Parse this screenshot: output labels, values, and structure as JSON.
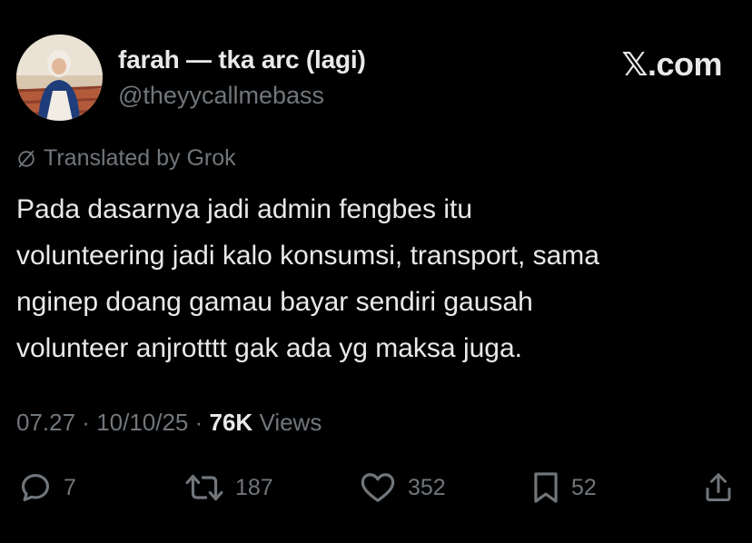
{
  "author": {
    "display_name": "farah — tka arc (lagi)",
    "handle": "@theyycallmebass",
    "avatar_icon": "profile-photo"
  },
  "brand": "𝕏.com",
  "translation_note": "Translated by Grok",
  "post_text": "Pada dasarnya jadi admin fengbes itu\nvolunteering jadi kalo konsumsi, transport, sama\nnginep doang gamau bayar sendiri gausah\nvolunteer anjrotttt gak ada yg maksa juga.",
  "meta": {
    "time": "07.27",
    "separator": " · ",
    "date": "10/10/25",
    "views_count": "76K",
    "views_label": "Views"
  },
  "actions": {
    "replies": "7",
    "reposts": "187",
    "likes": "352",
    "bookmarks": "52"
  },
  "colors": {
    "background": "#000000",
    "primary_text": "#e7e9ea",
    "secondary_text": "#71767b"
  }
}
